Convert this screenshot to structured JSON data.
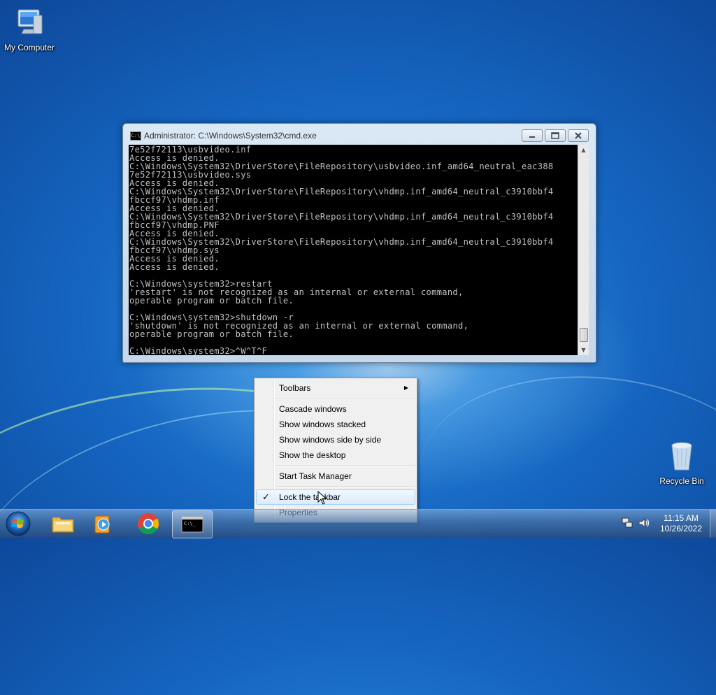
{
  "desktop": {
    "icons": [
      {
        "label": "My Computer",
        "icon": "computer-icon"
      },
      {
        "label": "Recycle Bin",
        "icon": "recycle-bin-icon"
      }
    ]
  },
  "cmd_window": {
    "title": "Administrator: C:\\Windows\\System32\\cmd.exe",
    "icon_glyph": "C:\\",
    "console_lines": [
      "7e52f72113\\usbvideo.inf",
      "Access is denied.",
      "C:\\Windows\\System32\\DriverStore\\FileRepository\\usbvideo.inf_amd64_neutral_eac388",
      "7e52f72113\\usbvideo.sys",
      "Access is denied.",
      "C:\\Windows\\System32\\DriverStore\\FileRepository\\vhdmp.inf_amd64_neutral_c3910bbf4",
      "fbccf97\\vhdmp.inf",
      "Access is denied.",
      "C:\\Windows\\System32\\DriverStore\\FileRepository\\vhdmp.inf_amd64_neutral_c3910bbf4",
      "fbccf97\\vhdmp.PNF",
      "Access is denied.",
      "C:\\Windows\\System32\\DriverStore\\FileRepository\\vhdmp.inf_amd64_neutral_c3910bbf4",
      "fbccf97\\vhdmp.sys",
      "Access is denied.",
      "Access is denied.",
      "",
      "C:\\Windows\\system32>restart",
      "'restart' is not recognized as an internal or external command,",
      "operable program or batch file.",
      "",
      "C:\\Windows\\system32>shutdown -r",
      "'shutdown' is not recognized as an internal or external command,",
      "operable program or batch file.",
      "",
      "C:\\Windows\\system32>^W^T^F"
    ]
  },
  "context_menu": {
    "items": [
      {
        "label": "Toolbars",
        "submenu": true
      },
      {
        "label": "Cascade windows"
      },
      {
        "label": "Show windows stacked"
      },
      {
        "label": "Show windows side by side"
      },
      {
        "label": "Show the desktop"
      },
      {
        "label": "Start Task Manager"
      },
      {
        "label": "Lock the taskbar",
        "checked": true,
        "highlighted": true
      },
      {
        "label": "Properties"
      }
    ],
    "check_glyph": "✓",
    "submenu_glyph": "▶"
  },
  "taskbar": {
    "pinned": [
      {
        "name": "windows-explorer",
        "icon": "folder-icon"
      },
      {
        "name": "media-player",
        "icon": "media-player-icon"
      },
      {
        "name": "chrome",
        "icon": "chrome-icon"
      },
      {
        "name": "command-prompt",
        "icon": "cmd-icon",
        "active": true
      }
    ],
    "clock": {
      "time": "11:15 AM",
      "date": "10/26/2022"
    }
  }
}
